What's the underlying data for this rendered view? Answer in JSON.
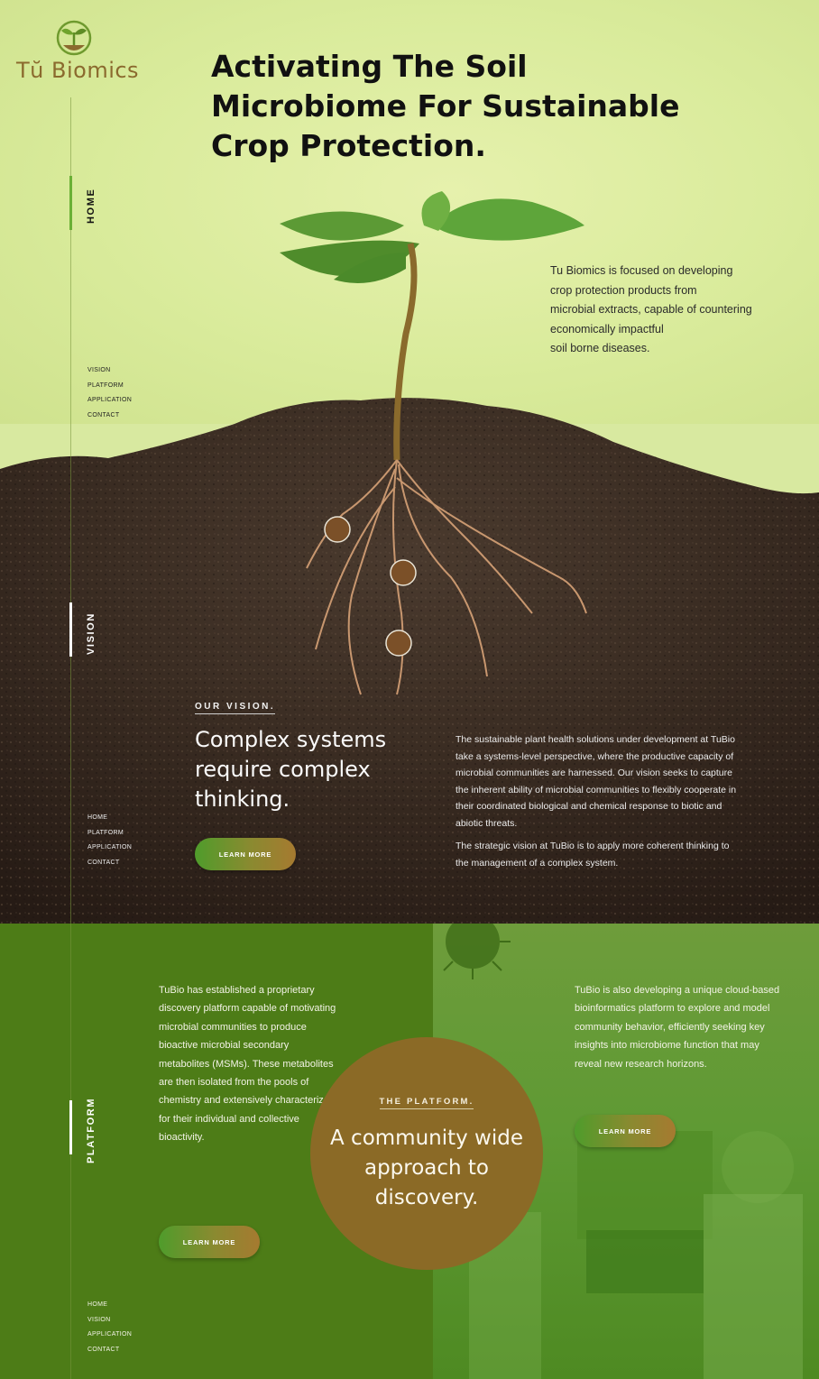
{
  "brand": {
    "name": "Tŭ Biomics",
    "primary_color": "#4d7c17",
    "accent_color": "#8b6a26"
  },
  "hero": {
    "title_line1": "Activating The Soil",
    "title_line2": "Microbiome For Sustainable",
    "title_line3": "Crop Protection.",
    "desc_line1": "Tu Biomics is focused on developing",
    "desc_line2": "crop protection products from",
    "desc_line3": "microbial extracts, capable of countering",
    "desc_line4": "economically impactful",
    "desc_line5": "soil borne diseases."
  },
  "side": {
    "home_label": "HOME",
    "vision_label": "VISION",
    "platform_label": "PLATFORM",
    "nav_home": [
      "VISION",
      "PLATFORM",
      "APPLICATION",
      "CONTACT"
    ],
    "nav_vision": [
      "HOME",
      "PLATFORM",
      "APPLICATION",
      "CONTACT"
    ],
    "nav_platform": [
      "HOME",
      "VISION",
      "APPLICATION",
      "CONTACT"
    ]
  },
  "vision": {
    "kicker": "OUR VISION.",
    "title": "Complex systems require complex thinking.",
    "body1": "The sustainable plant health solutions under development at TuBio take a systems-level perspective, where the productive capacity of microbial communities are harnessed. Our vision seeks to capture the inherent ability of microbial communities to flexibly cooperate in their coordinated biological and chemical response to biotic and abiotic threats.",
    "body2": "The strategic vision at TuBio is to apply more coherent thinking to the management of a complex system.",
    "button": "LEARN MORE"
  },
  "platform": {
    "left_text": "TuBio has established a proprietary discovery platform capable of motivating microbial communities to produce bioactive microbial secondary metabolites (MSMs). These metabolites are then isolated from the pools of chemistry and extensively characterized for their individual and collective bioactivity.",
    "right_text": "TuBio is also developing a unique cloud-based bioinformatics platform to explore and model community behavior, efficiently seeking key insights into microbiome function that may reveal new research horizons.",
    "circle_kicker": "THE PLATFORM.",
    "circle_title": "A community wide approach to discovery.",
    "left_button": "LEARN MORE",
    "right_button": "LEARN MORE"
  },
  "icons": [
    "sprout-logo-icon",
    "microbe-icon"
  ]
}
